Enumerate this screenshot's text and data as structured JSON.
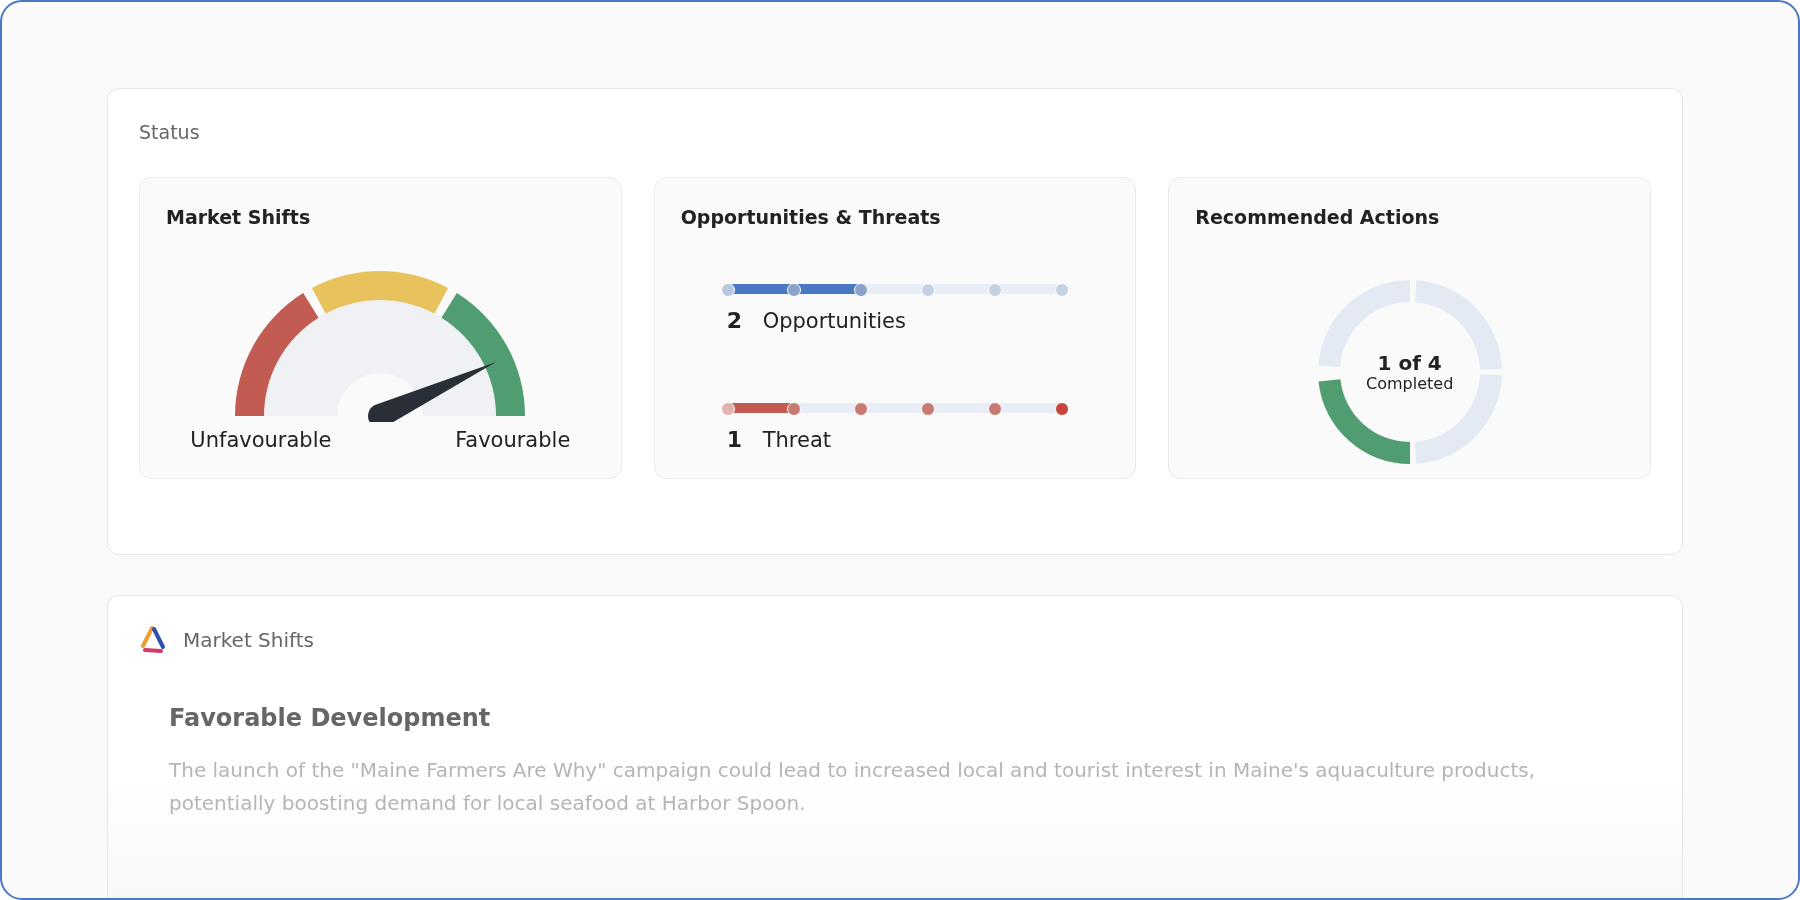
{
  "status": {
    "title": "Status",
    "market_shifts": {
      "title": "Market Shifts",
      "left_label": "Unfavourable",
      "right_label": "Favourable"
    },
    "opportunities_threats": {
      "title": "Opportunities & Threats",
      "tracks": [
        {
          "kind": "opportunity",
          "count": "2",
          "label": "Opportunities",
          "level": 0.4
        },
        {
          "kind": "threat",
          "count": "1",
          "label": "Threat",
          "level": 0.2
        }
      ]
    },
    "recommended_actions": {
      "title": "Recommended Actions",
      "count": "1 of 4",
      "caption": "Completed",
      "segments": [
        {
          "completed": true
        },
        {
          "completed": false
        },
        {
          "completed": false
        },
        {
          "completed": false
        }
      ]
    }
  },
  "detail": {
    "title": "Market Shifts",
    "heading": "Favorable Development",
    "body": "The launch of the \"Maine Farmers Are Why\" campaign could lead to increased local and tourist interest in Maine's aquaculture products, potentially boosting demand for local seafood at Harbor Spoon."
  }
}
